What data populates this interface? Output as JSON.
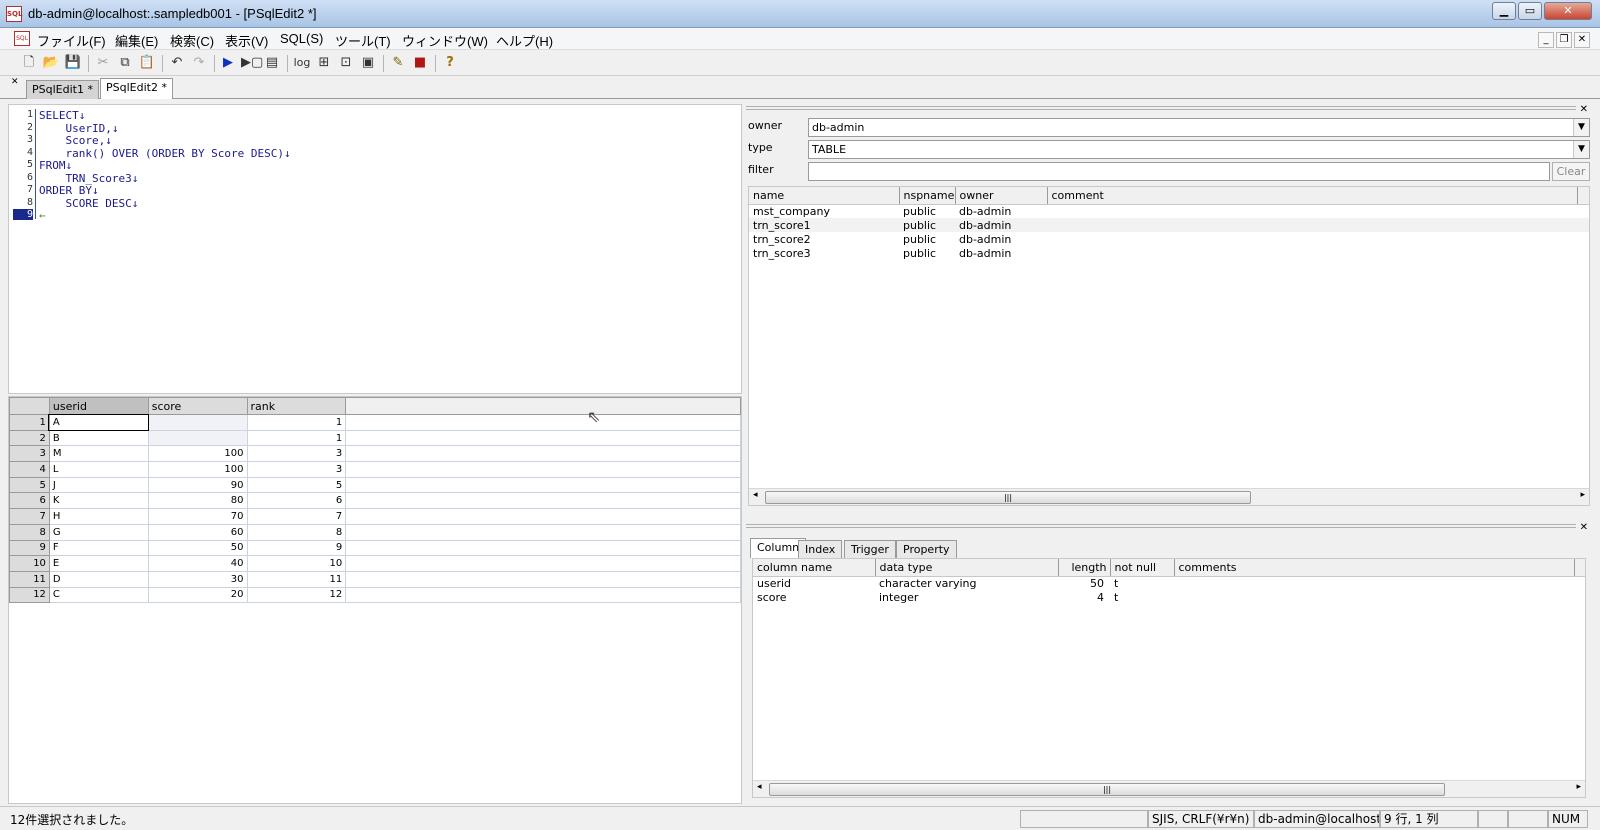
{
  "window": {
    "title": "db-admin@localhost:.sampledb001 - [PSqlEdit2 *]"
  },
  "menu": [
    "ファイル(F)",
    "編集(E)",
    "検索(C)",
    "表示(V)",
    "SQL(S)",
    "ツール(T)",
    "ウィンドウ(W)",
    "ヘルプ(H)"
  ],
  "toolbar": {
    "log_label": "log"
  },
  "tabs": [
    "PSqlEdit1 *",
    "PSqlEdit2 *"
  ],
  "editor": {
    "lines": [
      {
        "n": "1",
        "text": "SELECT↓"
      },
      {
        "n": "2",
        "text": "    UserID,↓"
      },
      {
        "n": "3",
        "text": "    Score,↓"
      },
      {
        "n": "4",
        "text": "    rank() OVER (ORDER BY Score DESC)↓"
      },
      {
        "n": "5",
        "text": "FROM↓"
      },
      {
        "n": "6",
        "text": "    TRN_Score3↓"
      },
      {
        "n": "7",
        "text": "ORDER BY↓"
      },
      {
        "n": "8",
        "text": "    SCORE DESC↓"
      },
      {
        "n": "9",
        "text": "←"
      }
    ]
  },
  "result": {
    "columns": [
      "userid",
      "score",
      "rank"
    ],
    "rows": [
      [
        "1",
        "A",
        "",
        "1"
      ],
      [
        "2",
        "B",
        "",
        "1"
      ],
      [
        "3",
        "M",
        "100",
        "3"
      ],
      [
        "4",
        "L",
        "100",
        "3"
      ],
      [
        "5",
        "J",
        "90",
        "5"
      ],
      [
        "6",
        "K",
        "80",
        "6"
      ],
      [
        "7",
        "H",
        "70",
        "7"
      ],
      [
        "8",
        "G",
        "60",
        "8"
      ],
      [
        "9",
        "F",
        "50",
        "9"
      ],
      [
        "10",
        "E",
        "40",
        "10"
      ],
      [
        "11",
        "D",
        "30",
        "11"
      ],
      [
        "12",
        "C",
        "20",
        "12"
      ]
    ]
  },
  "objects": {
    "owner_label": "owner",
    "owner_value": "db-admin",
    "type_label": "type",
    "type_value": "TABLE",
    "filter_label": "filter",
    "filter_value": "",
    "clear_label": "Clear",
    "columns": [
      "name",
      "nspname",
      "owner",
      "comment"
    ],
    "rows": [
      [
        "mst_company",
        "public",
        "db-admin",
        ""
      ],
      [
        "trn_score1",
        "public",
        "db-admin",
        ""
      ],
      [
        "trn_score2",
        "public",
        "db-admin",
        ""
      ],
      [
        "trn_score3",
        "public",
        "db-admin",
        ""
      ]
    ]
  },
  "detail": {
    "tabs": [
      "Column",
      "Index",
      "Trigger",
      "Property"
    ],
    "columns": [
      "column name",
      "data type",
      "length",
      "not null",
      "comments"
    ],
    "rows": [
      [
        "userid",
        "character varying",
        "50",
        "t",
        ""
      ],
      [
        "score",
        "integer",
        "4",
        "t",
        ""
      ]
    ]
  },
  "status": {
    "message": "12件選択されました。",
    "encoding": "SJIS, CRLF(¥r¥n)",
    "connection": "db-admin@localhost:",
    "position": "9 行, 1 列",
    "num": "NUM"
  }
}
